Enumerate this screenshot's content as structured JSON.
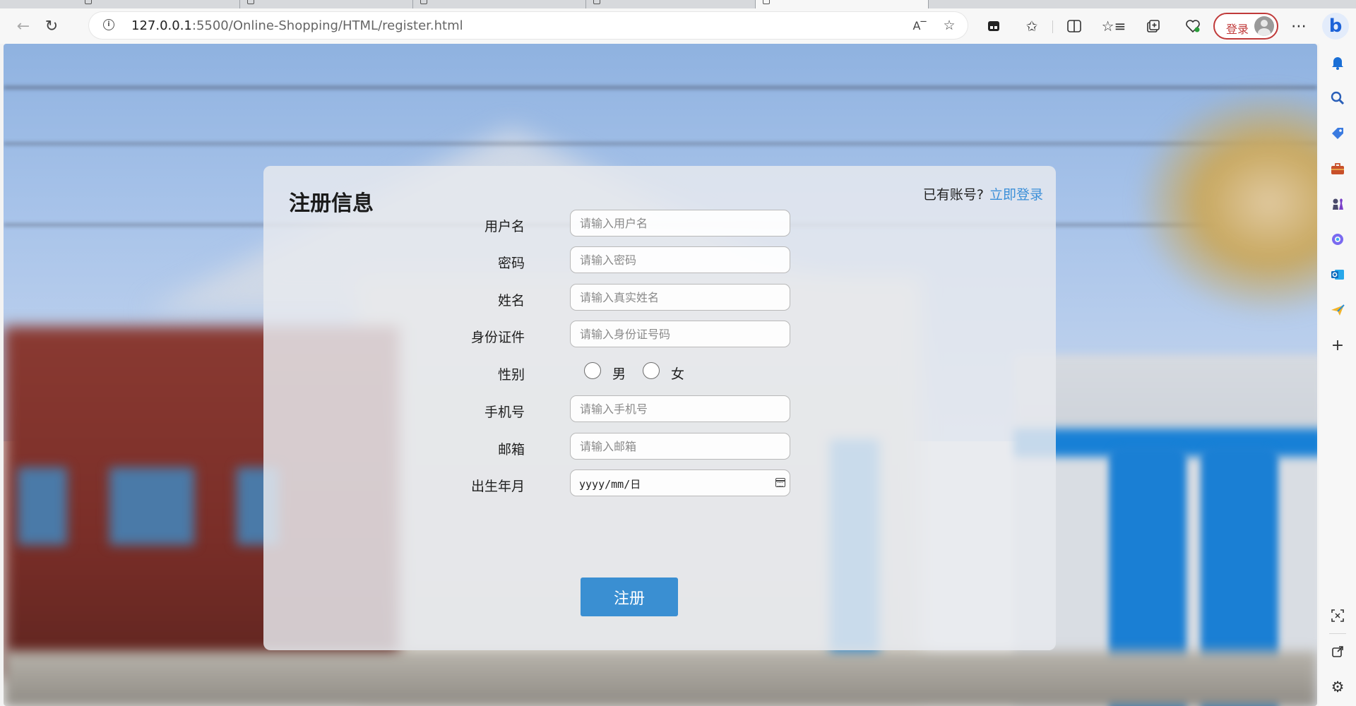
{
  "browser": {
    "address": {
      "host": "127.0.0.1",
      "path": ":5500/Online-Shopping/HTML/register.html"
    },
    "profile_button_label": "登录",
    "icons": {
      "back": "back-arrow-icon",
      "refresh": "refresh-icon",
      "info": "site-info-icon",
      "read_aloud": "read-aloud-icon",
      "favorite": "star-icon",
      "extensions": "puzzle-icon",
      "split": "split-screen-icon",
      "favorites": "favorites-icon",
      "collections": "collections-icon",
      "performance": "heart-pulse-icon",
      "more": "more-dots-icon",
      "copilot": "bing-icon"
    }
  },
  "sidepanel": {
    "icons": [
      "bell-icon",
      "search-icon",
      "tag-icon",
      "toolbox-icon",
      "chess-icon",
      "copilot-icon",
      "outlook-icon",
      "send-icon",
      "add-icon",
      "screenshot-icon",
      "open-external-icon",
      "settings-icon"
    ]
  },
  "form": {
    "title": "注册信息",
    "have_account": "已有账号?",
    "login_link": "立即登录",
    "fields": {
      "username": {
        "label": "用户名",
        "placeholder": "请输入用户名"
      },
      "password": {
        "label": "密码",
        "placeholder": "请输入密码"
      },
      "name": {
        "label": "姓名",
        "placeholder": "请输入真实姓名"
      },
      "id_card": {
        "label": "身份证件",
        "placeholder": "请输入身份证号码"
      },
      "gender": {
        "label": "性别",
        "options": [
          "男",
          "女"
        ]
      },
      "phone": {
        "label": "手机号",
        "placeholder": "请输入手机号"
      },
      "email": {
        "label": "邮箱",
        "placeholder": "请输入邮箱"
      },
      "birth": {
        "label": "出生年月",
        "value": "yyyy/mm/日"
      }
    },
    "submit_label": "注册"
  },
  "colors": {
    "accent": "#3a8fd2",
    "link": "#3b8fd8",
    "login_border": "#c03a3a"
  }
}
